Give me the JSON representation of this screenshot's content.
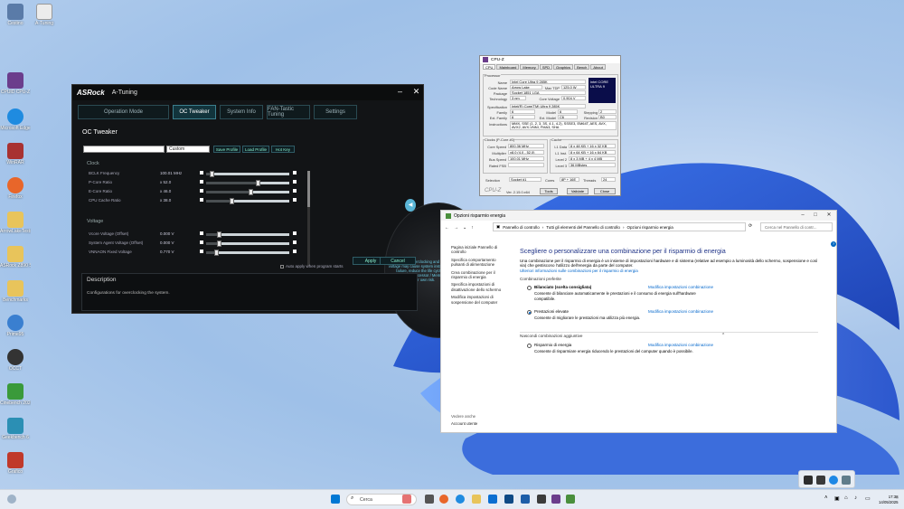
{
  "desktop": {
    "icons": [
      {
        "label": "Cestino",
        "color": "#5a7ba8"
      },
      {
        "label": "A-Tuning",
        "color": "#ececec"
      },
      {
        "label": "CPUID CPU-Z",
        "color": "#6b3d8c"
      },
      {
        "label": "Microsoft Edge",
        "color": "#1f8be0"
      },
      {
        "label": "WinRAR",
        "color": "#a83232"
      },
      {
        "label": "Firefox",
        "color": "#e8662a"
      },
      {
        "label": "ArrowLakeTests",
        "color": "#e8c45b"
      },
      {
        "label": "ASRock Z890 Steel Legend",
        "color": "#e8c45b"
      },
      {
        "label": "Benchmarks",
        "color": "#e8c45b"
      },
      {
        "label": "Prime95",
        "color": "#3a7fd0"
      },
      {
        "label": "OCCT",
        "color": "#333333"
      },
      {
        "label": "Cinebench 2024",
        "color": "#3a9a3a"
      },
      {
        "label": "Geekbench 6",
        "color": "#2b8fb4"
      },
      {
        "label": "Grafico",
        "color": "#c0392b"
      }
    ]
  },
  "atuning": {
    "logo": "ASRock",
    "app": "A-Tuning",
    "tabs": [
      "Operation Mode",
      "OC Tweaker",
      "System Info",
      "FAN-Tastic Tuning",
      "Settings"
    ],
    "active_tab": "OC Tweaker",
    "section_title": "OC Tweaker",
    "profile_value": "Custom",
    "buttons": {
      "save_profile": "Save Profile",
      "load_profile": "Load Profile",
      "hot_key": "Hot Key",
      "apply": "Apply",
      "cancel": "Cancel"
    },
    "groups": {
      "clock": "Clock",
      "voltage": "Voltage"
    },
    "clock_rows": [
      {
        "name": "BCLK Frequency",
        "value": "100.01 MHz",
        "level": 0.06
      },
      {
        "name": "P-Core Ratio",
        "value": "x 52.0",
        "level": 0.62
      },
      {
        "name": "E-Core Ratio",
        "value": "x 46.0",
        "level": 0.53
      },
      {
        "name": "CPU Cache Ratio",
        "value": "x 38.0",
        "level": 0.3
      }
    ],
    "voltage_rows": [
      {
        "name": "Vcore Voltage (Offset)",
        "value": "0.000 V",
        "level": 0.15
      },
      {
        "name": "System Agent Voltage (Offset)",
        "value": "0.000 V",
        "level": 0.15
      },
      {
        "name": "VNNAON Fixed Voltage",
        "value": "0.770 V",
        "level": 0.12
      }
    ],
    "caution": "CAUTION: Overclocking and setting voltage may cause system instability or failure, reduce the life cycle of Motherboard / Processor / Memory. Do it at your own risk.",
    "auto_apply": "Auto apply when program starts",
    "description_title": "Description",
    "description_text": "Configurations for overclocking the system."
  },
  "cpuz": {
    "title": "CPU-Z",
    "tabs": [
      "CPU",
      "Mainboard",
      "Memory",
      "SPD",
      "Graphics",
      "Bench",
      "About"
    ],
    "processor_label": "Processor",
    "fields": [
      {
        "label": "Name",
        "value": "Intel Core Ultra 9 285K"
      },
      {
        "label": "Code Name",
        "value": "Arrow Lake"
      },
      {
        "label": "Max TDP",
        "value": "125.0 W"
      },
      {
        "label": "Package",
        "value": "Socket 1851 LGA"
      },
      {
        "label": "Technology",
        "value": "3 nm"
      },
      {
        "label": "Core Voltage",
        "value": "0.904 V"
      },
      {
        "label": "Specification",
        "value": "Intel(R) Core(TM) Ultra 9 285K"
      },
      {
        "label": "Family",
        "value": "6"
      },
      {
        "label": "Model",
        "value": "6"
      },
      {
        "label": "Stepping",
        "value": "2"
      },
      {
        "label": "Ext. Family",
        "value": "6"
      },
      {
        "label": "Ext. Model",
        "value": "C6"
      },
      {
        "label": "Revision",
        "value": "B0"
      },
      {
        "label": "Instructions",
        "value": "MMX, SSE (1, 2, 3, 3S, 4.1, 4.2), SSSE3, EM64T, AES, AVX, AVX2, AVX-VNNI, FMA3, SHA"
      }
    ],
    "clocks_label": "Clocks (P-Core #0)",
    "clocks": [
      {
        "label": "Core Speed",
        "value": "800.36 MHz"
      },
      {
        "label": "Multiplier",
        "value": "x8.0 (4.0 - 52.0)"
      },
      {
        "label": "Bus Speed",
        "value": "100.01 MHz"
      },
      {
        "label": "Rated FSB",
        "value": ""
      }
    ],
    "cache_label": "Cache",
    "cache": [
      {
        "label": "L1 Data",
        "value": "8 x 48 KB + 16 x 32 KB"
      },
      {
        "label": "L1 Inst.",
        "value": "8 x 64 KB + 16 x 64 KB"
      },
      {
        "label": "Level 2",
        "value": "8 x 3 MB + 4 x 4 MB"
      },
      {
        "label": "Level 3",
        "value": "36 MBytes"
      }
    ],
    "selection_label": "Selection",
    "selection_value": "Socket #1",
    "cores_label": "Cores",
    "cores_value": "8P + 16E",
    "threads_label": "Threads",
    "threads_value": "24",
    "brand": "CPU-Z",
    "version": "Ver. 2.15.0.x64",
    "tools": "Tools",
    "validate": "Validate",
    "close": "Close",
    "intel_badge": "intel CORE ULTRA 9"
  },
  "control_panel": {
    "title": "Opzioni risparmio energia",
    "breadcrumb": [
      "Pannello di controllo",
      "Tutti gli elementi del Pannello di controllo",
      "Opzioni risparmio energia"
    ],
    "search_placeholder": "Cerca nel Pannello di contr...",
    "left_links": [
      "Pagina iniziale Pannello di controllo",
      "Specifica comportamento pulsanti di alimentazione",
      "Crea combinazione per il risparmio di energia",
      "Specifica impostazioni di disattivazione dello schermo",
      "Modifica impostazioni di sospensione del computer"
    ],
    "see_also": "Vedere anche",
    "user_accounts": "Account utente",
    "heading": "Scegliere o personalizzare una combinazione per il risparmio di energia",
    "intro": "Una combinazione per il risparmio di energia è un insieme di impostazioni hardware e di sistema (relative ad esempio a luminosità dello schermo, sospensione e così via) che gestiscono l'utilizzo dell'energia da parte del computer.",
    "intro_link": "Ulteriori informazioni sulle combinazioni per il risparmio di energia",
    "preferred": "Combinazioni preferite",
    "plans": [
      {
        "name": "Bilanciato (scelta consigliata)",
        "desc": "Consente di bilanciare automaticamente le prestazioni e il consumo di energia sull'hardware compatibile.",
        "change": "Modifica impostazioni combinazione",
        "selected": false
      },
      {
        "name": "Prestazioni elevate",
        "desc": "Consente di migliorare le prestazioni ma utilizza più energia.",
        "change": "Modifica impostazioni combinazione",
        "selected": true
      }
    ],
    "hidden_label": "Nascondi combinazioni aggiuntive",
    "extra_plan": {
      "name": "Risparmio di energia",
      "desc": "Consente di risparmiare energia riducendo le prestazioni del computer quando è possibile.",
      "change": "Modifica impostazioni combinazione",
      "selected": false
    }
  },
  "taskbar": {
    "search_placeholder": "Cerca",
    "time": "17:38",
    "date": "14/05/2025"
  }
}
